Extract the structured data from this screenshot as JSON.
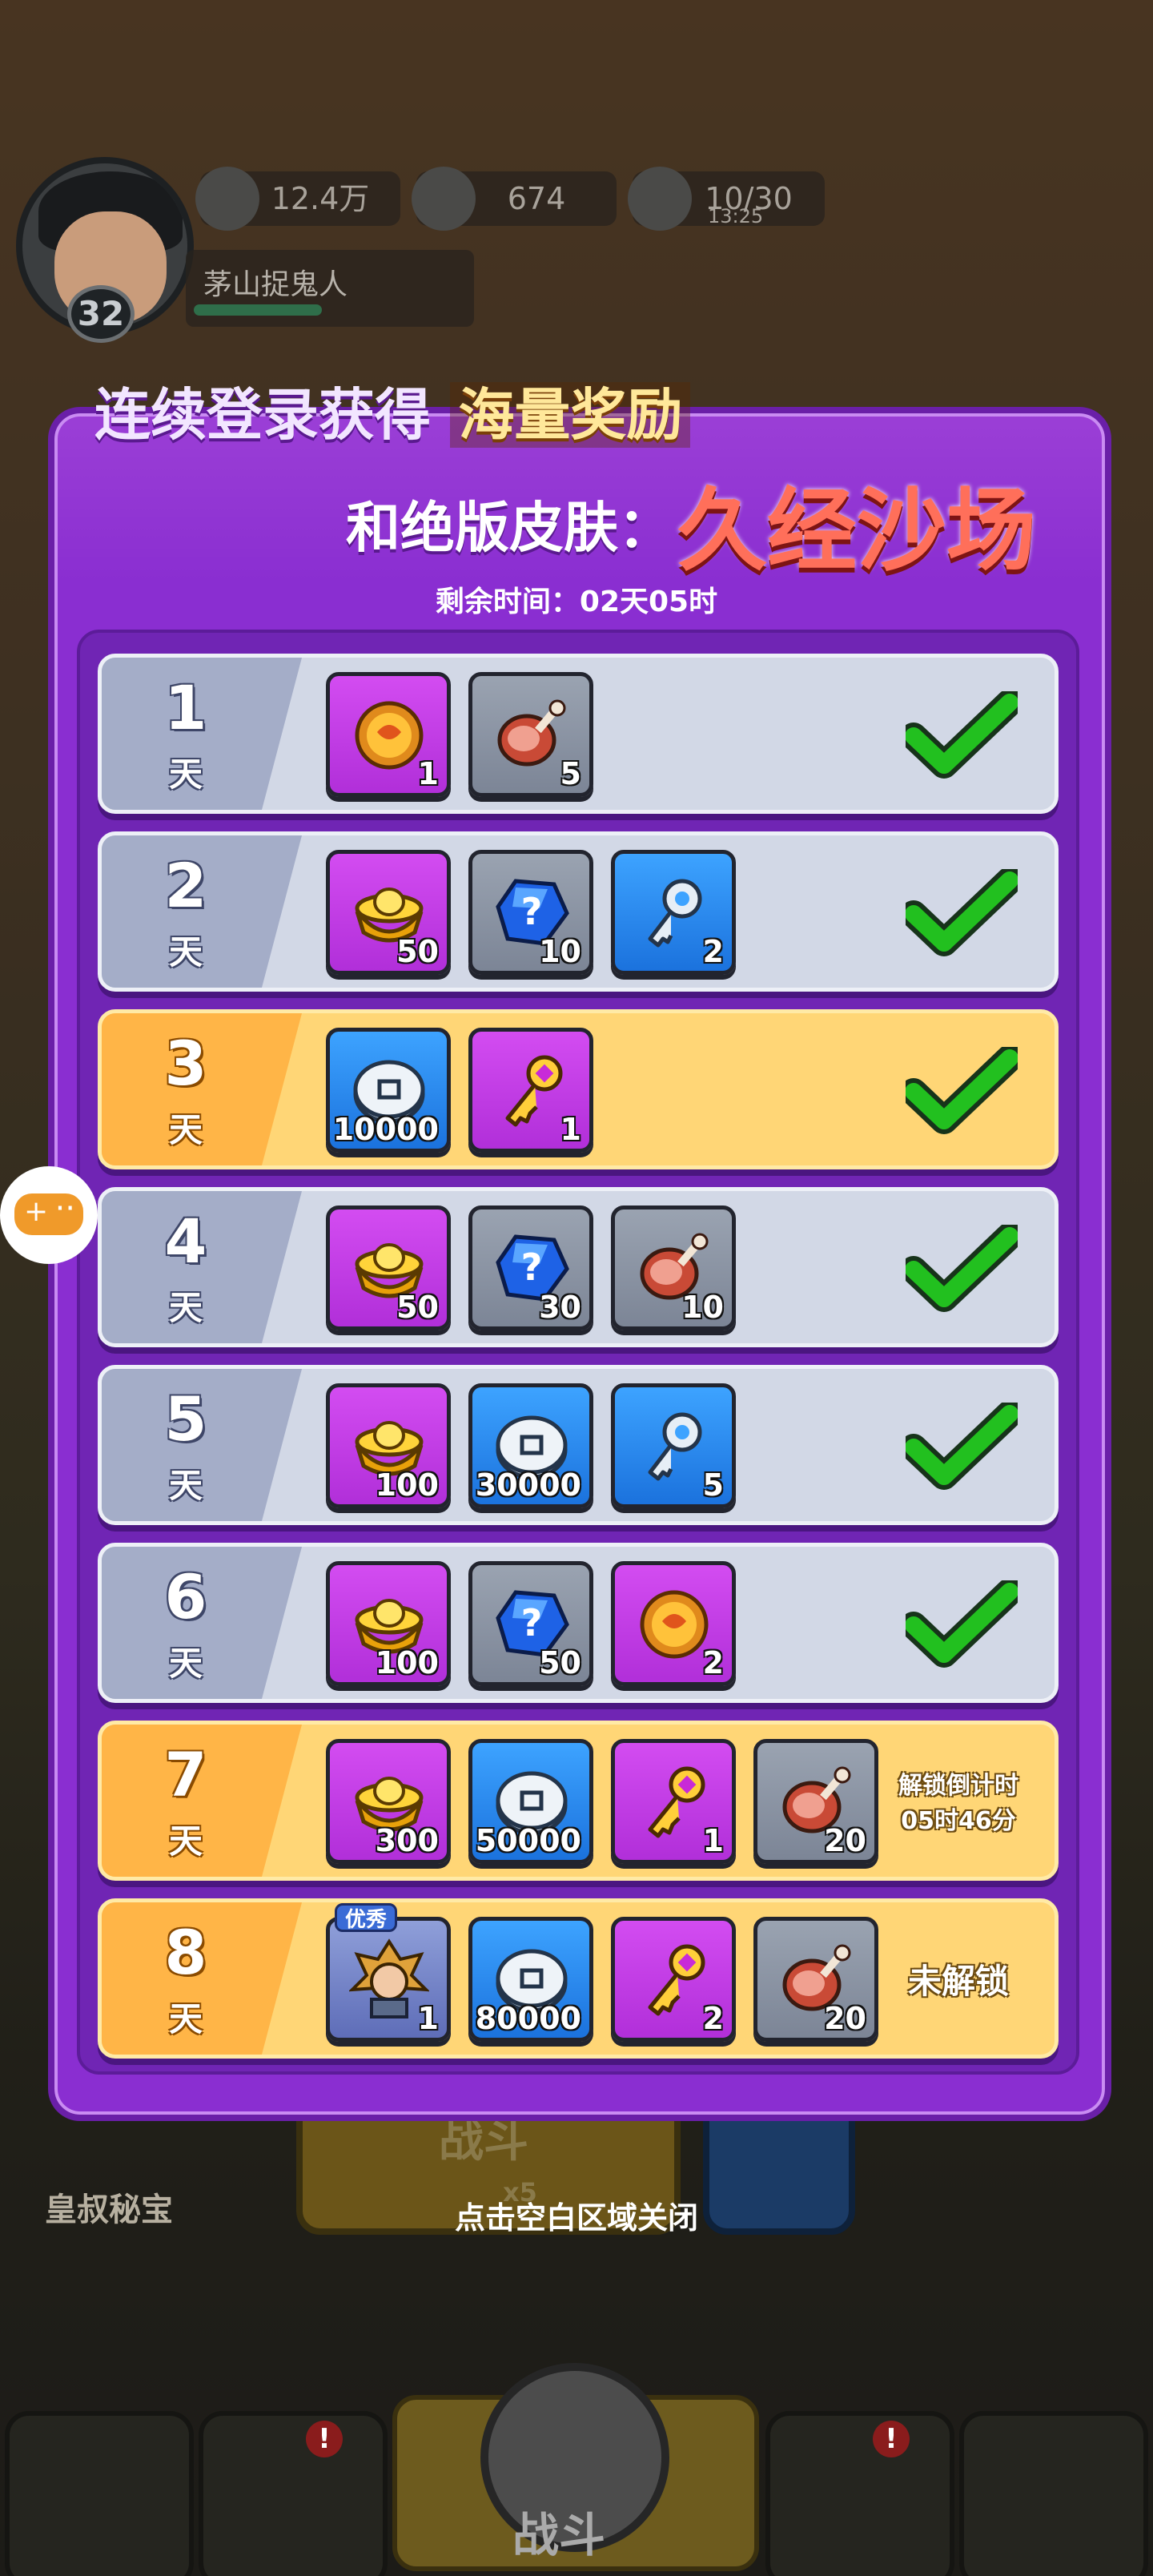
{
  "hud": {
    "silver": "12.4万",
    "gold": "674",
    "stamina": "10/30",
    "stamina_timer": "13:25",
    "player_name": "茅山捉鬼人",
    "level": "32"
  },
  "modal": {
    "title_part1": "连续登录获得",
    "title_highlight": "海量奖励",
    "subtitle": "和绝版皮肤：",
    "skin_name": "久经沙场",
    "remaining": "剩余时间：02天05时",
    "close_hint": "点击空白区域关闭"
  },
  "day_suffix": "天",
  "days": [
    {
      "num": "1",
      "style": "grey",
      "state": "claimed",
      "items": [
        {
          "icon": "copper-coin-icon",
          "bg": "purple",
          "count": "1"
        },
        {
          "icon": "meat-icon",
          "bg": "grey",
          "count": "5"
        }
      ]
    },
    {
      "num": "2",
      "style": "grey",
      "state": "claimed",
      "items": [
        {
          "icon": "gold-ingot-icon",
          "bg": "purple",
          "count": "50"
        },
        {
          "icon": "mystery-gem-icon",
          "bg": "grey",
          "count": "10"
        },
        {
          "icon": "silver-key-icon",
          "bg": "blue",
          "count": "2"
        }
      ]
    },
    {
      "num": "3",
      "style": "gold",
      "state": "claimed",
      "items": [
        {
          "icon": "silver-coin-icon",
          "bg": "blue",
          "count": "10000"
        },
        {
          "icon": "gold-key-icon",
          "bg": "purple",
          "count": "1"
        }
      ]
    },
    {
      "num": "4",
      "style": "grey",
      "state": "claimed",
      "items": [
        {
          "icon": "gold-ingot-icon",
          "bg": "purple",
          "count": "50"
        },
        {
          "icon": "mystery-gem-icon",
          "bg": "grey",
          "count": "30"
        },
        {
          "icon": "meat-icon",
          "bg": "grey",
          "count": "10"
        }
      ]
    },
    {
      "num": "5",
      "style": "grey",
      "state": "claimed",
      "items": [
        {
          "icon": "gold-ingot-icon",
          "bg": "purple",
          "count": "100"
        },
        {
          "icon": "silver-coin-icon",
          "bg": "blue",
          "count": "30000"
        },
        {
          "icon": "silver-key-icon",
          "bg": "blue",
          "count": "5"
        }
      ]
    },
    {
      "num": "6",
      "style": "grey",
      "state": "claimed",
      "items": [
        {
          "icon": "gold-ingot-icon",
          "bg": "purple",
          "count": "100"
        },
        {
          "icon": "mystery-gem-icon",
          "bg": "grey",
          "count": "50"
        },
        {
          "icon": "copper-coin-icon",
          "bg": "purple",
          "count": "2"
        }
      ]
    },
    {
      "num": "7",
      "style": "gold",
      "state": "countdown",
      "status_line1": "解锁倒计时",
      "status_line2": "05时46分",
      "items": [
        {
          "icon": "gold-ingot-icon",
          "bg": "purple",
          "count": "300"
        },
        {
          "icon": "silver-coin-icon",
          "bg": "blue",
          "count": "50000"
        },
        {
          "icon": "gold-key-icon",
          "bg": "purple",
          "count": "1"
        },
        {
          "icon": "meat-icon",
          "bg": "grey",
          "count": "20"
        }
      ]
    },
    {
      "num": "8",
      "style": "gold",
      "state": "locked",
      "status_line1": "未解锁",
      "items": [
        {
          "icon": "hero-skin-icon",
          "bg": "hero",
          "count": "1",
          "tag": "优秀"
        },
        {
          "icon": "silver-coin-icon",
          "bg": "blue",
          "count": "80000"
        },
        {
          "icon": "gold-key-icon",
          "bg": "purple",
          "count": "2"
        },
        {
          "icon": "meat-icon",
          "bg": "grey",
          "count": "20"
        }
      ]
    }
  ],
  "background": {
    "treasure_label": "皇叔秘宝",
    "battle_label": "战斗",
    "stamina_cost": "x5",
    "nav_fight": "战斗",
    "nav_badge": "!"
  },
  "colors": {
    "panel": "#8a2ed1",
    "row_grey": "#d2d8e6",
    "row_gold": "#ffd676",
    "check": "#22c01f",
    "title_red": "#ff6f5a"
  }
}
